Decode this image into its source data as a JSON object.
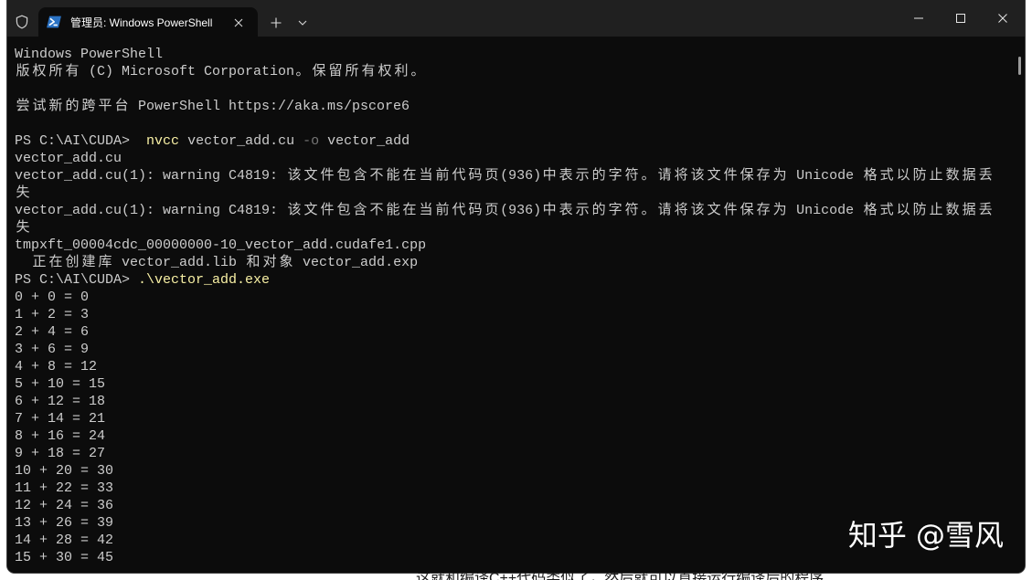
{
  "window": {
    "tab": {
      "title": "管理员: Windows PowerShell",
      "icon": "powershell-icon",
      "close_icon": "close-icon"
    },
    "admin_icon": "shield-icon",
    "new_tab_icon": "plus-icon",
    "dropdown_icon": "chevron-down-icon",
    "controls": [
      "minimize-icon",
      "maximize-icon",
      "close-icon"
    ]
  },
  "theme": {
    "background": "#0c0c0c",
    "foreground": "#cccccc",
    "command": "#f9f1a5",
    "parameter": "#767676",
    "tab_bar": "#202020",
    "tab_active": "#0c0c0c"
  },
  "terminal": {
    "banner": {
      "title": "Windows PowerShell",
      "copyright": "版权所有 (C) Microsoft Corporation。保留所有权利。",
      "tip": "尝试新的跨平台 PowerShell https://aka.ms/pscore6"
    },
    "commands": [
      {
        "prompt": "PS C:\\AI\\CUDA>  ",
        "command": "nvcc",
        "args": [
          "vector_add.cu",
          "-o",
          "vector_add"
        ],
        "output": [
          "vector_add.cu",
          "vector_add.cu(1): warning C4819: 该文件包含不能在当前代码页(936)中表示的字符。请将该文件保存为 Unicode 格式以防止数据丢",
          "失",
          "vector_add.cu(1): warning C4819: 该文件包含不能在当前代码页(936)中表示的字符。请将该文件保存为 Unicode 格式以防止数据丢",
          "失",
          "tmpxft_00004cdc_00000000-10_vector_add.cudafe1.cpp",
          "  正在创建库 vector_add.lib 和对象 vector_add.exp"
        ]
      },
      {
        "prompt": "PS C:\\AI\\CUDA> ",
        "command": ".\\vector_add.exe",
        "output": [
          "0 + 0 = 0",
          "1 + 2 = 3",
          "2 + 4 = 6",
          "3 + 6 = 9",
          "4 + 8 = 12",
          "5 + 10 = 15",
          "6 + 12 = 18",
          "7 + 14 = 21",
          "8 + 16 = 24",
          "9 + 18 = 27",
          "10 + 20 = 30",
          "11 + 22 = 33",
          "12 + 24 = 36",
          "13 + 26 = 39",
          "14 + 28 = 42",
          "15 + 30 = 45"
        ]
      }
    ]
  },
  "watermark": "知乎 @雪风",
  "page_behind": {
    "caption": "这就和编译C++代码类似了，然后就可以直接运行编译后的程序"
  }
}
